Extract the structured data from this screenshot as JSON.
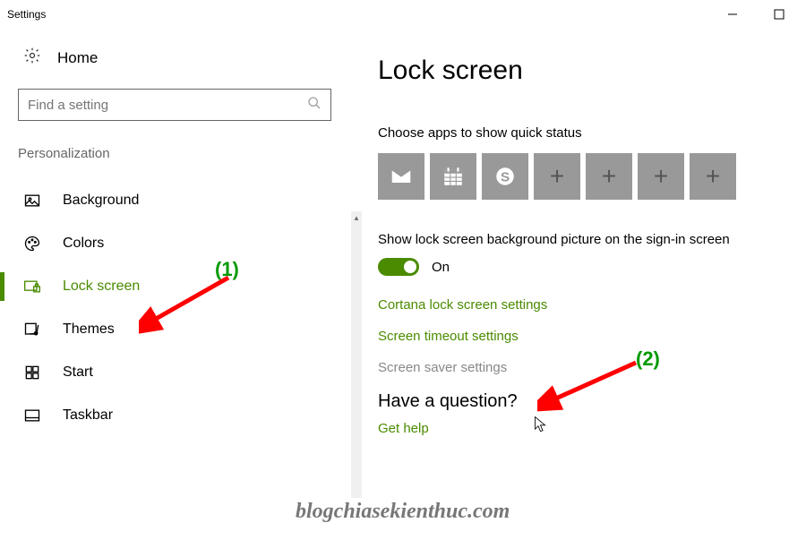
{
  "window": {
    "title": "Settings"
  },
  "sidebar": {
    "home": "Home",
    "search_placeholder": "Find a setting",
    "category": "Personalization",
    "items": [
      {
        "label": "Background",
        "icon": "picture-icon"
      },
      {
        "label": "Colors",
        "icon": "palette-icon"
      },
      {
        "label": "Lock screen",
        "icon": "lockscreen-icon"
      },
      {
        "label": "Themes",
        "icon": "themes-icon"
      },
      {
        "label": "Start",
        "icon": "start-icon"
      },
      {
        "label": "Taskbar",
        "icon": "taskbar-icon"
      }
    ]
  },
  "main": {
    "title": "Lock screen",
    "quick_status_label": "Choose apps to show quick status",
    "bg_toggle_label": "Show lock screen background picture on the sign-in screen",
    "toggle_state": "On",
    "links": {
      "cortana": "Cortana lock screen settings",
      "timeout": "Screen timeout settings",
      "saver": "Screen saver settings"
    },
    "help_heading": "Have a question?",
    "help_link": "Get help"
  },
  "annotations": {
    "one": "(1)",
    "two": "(2)",
    "watermark": "blogchiasekienthuc.com"
  }
}
